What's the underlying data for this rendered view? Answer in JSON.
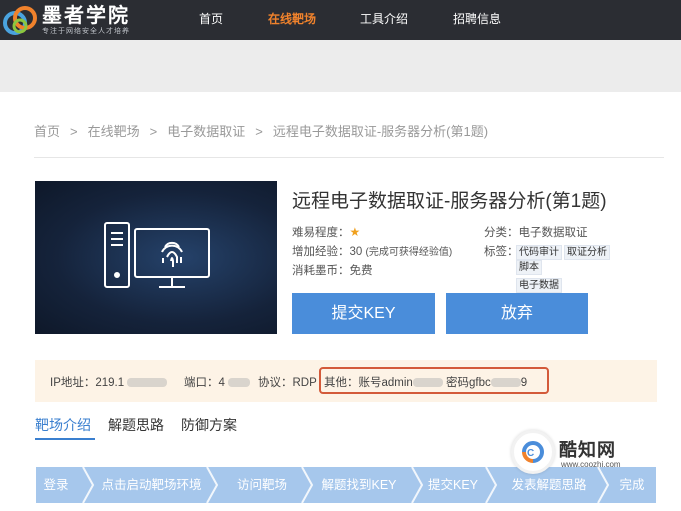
{
  "brand": {
    "name": "墨者学院",
    "slogan": "专注于网络安全人才培养"
  },
  "nav": {
    "items": [
      {
        "label": "首页"
      },
      {
        "label": "在线靶场"
      },
      {
        "label": "工具介绍"
      },
      {
        "label": "招聘信息"
      }
    ],
    "active_index": 1
  },
  "breadcrumb": [
    "首页",
    "在线靶场",
    "电子数据取证",
    "远程电子数据取证-服务器分析(第1题)"
  ],
  "breadcrumb_sep": ">",
  "challenge": {
    "title": "远程电子数据取证-服务器分析(第1题)",
    "difficulty_label": "难易程度：",
    "difficulty_star": "★",
    "difficulty_stars": 1,
    "exp_label": "增加经验：",
    "exp_value": "30",
    "exp_note": "(完成可获得经验值)",
    "cost_label": "消耗墨币：",
    "cost_value": "免费",
    "category_label": "分类：",
    "category_value": "电子数据取证",
    "tags_label": "标签：",
    "tags": [
      "代码审计",
      "取证分析",
      "脚本",
      "电子数据"
    ]
  },
  "buttons": {
    "submit_key": "提交KEY",
    "give_up": "放弃"
  },
  "connection": {
    "ip_label": "IP地址：",
    "ip_value": "219.1",
    "port_label": "端口：",
    "port_value": "4",
    "protocol_label": "协议：",
    "protocol_value": "RDP",
    "other_label": "其他：",
    "account_label": "账号admin",
    "password_label": "密码gfbc",
    "password_tail": "9"
  },
  "tabs": [
    {
      "label": "靶场介绍"
    },
    {
      "label": "解题思路"
    },
    {
      "label": "防御方案"
    }
  ],
  "active_tab": 0,
  "steps": [
    {
      "label": "登录"
    },
    {
      "label": "点击启动靶场环境"
    },
    {
      "label": "访问靶场"
    },
    {
      "label": "解题找到KEY"
    },
    {
      "label": "提交KEY"
    },
    {
      "label": "发表解题思路"
    },
    {
      "label": "完成"
    }
  ],
  "watermark": {
    "name": "酷知网",
    "url": "www.coozhi.com"
  },
  "colors": {
    "topbar": "#2b2d33",
    "nav_active": "#f0822c",
    "button": "#4a8dda",
    "info_bg": "#fdf3e6",
    "highlight_border": "#d35a3a",
    "tab_active": "#3a7fcf",
    "steps_bg": "#a6c7ec"
  }
}
